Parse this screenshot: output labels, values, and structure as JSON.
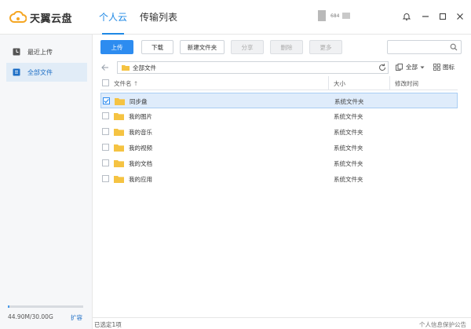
{
  "app": {
    "title": "天翼云盘"
  },
  "nav": {
    "tabs": [
      {
        "label": "个人云",
        "active": true
      },
      {
        "label": "传输列表",
        "active": false
      }
    ]
  },
  "user": {
    "name": "684"
  },
  "sidebar": {
    "items": [
      {
        "label": "最近上传",
        "icon": "clock-icon",
        "active": false
      },
      {
        "label": "全部文件",
        "icon": "files-icon",
        "active": true
      }
    ],
    "quota": {
      "text": "44.90M/30.00G",
      "used_fraction": 0.0015,
      "expand_label": "扩容"
    }
  },
  "toolbar": {
    "upload": "上传",
    "download": "下载",
    "new_folder": "新建文件夹",
    "share": "分享",
    "delete": "删除",
    "more": "更多",
    "search_placeholder": ""
  },
  "path": {
    "current": "全部文件"
  },
  "view": {
    "filter_label": "全部",
    "grid_label": "图标"
  },
  "table": {
    "headers": {
      "name": "文件名",
      "size": "大小",
      "modified": "修改时间"
    },
    "rows": [
      {
        "name": "同步盘",
        "type": "系统文件夹",
        "selected": true
      },
      {
        "name": "我的图片",
        "type": "系统文件夹",
        "selected": false
      },
      {
        "name": "我的音乐",
        "type": "系统文件夹",
        "selected": false
      },
      {
        "name": "我的视频",
        "type": "系统文件夹",
        "selected": false
      },
      {
        "name": "我的文档",
        "type": "系统文件夹",
        "selected": false
      },
      {
        "name": "我的应用",
        "type": "系统文件夹",
        "selected": false
      }
    ]
  },
  "status": {
    "selected_text": "已选定1项",
    "privacy_link": "个人信息保护公告"
  },
  "colors": {
    "accent": "#2d8cf0",
    "folder": "#f5c342",
    "selected_row": "#dfecfb",
    "sidebar_bg": "#f6f7f9"
  }
}
